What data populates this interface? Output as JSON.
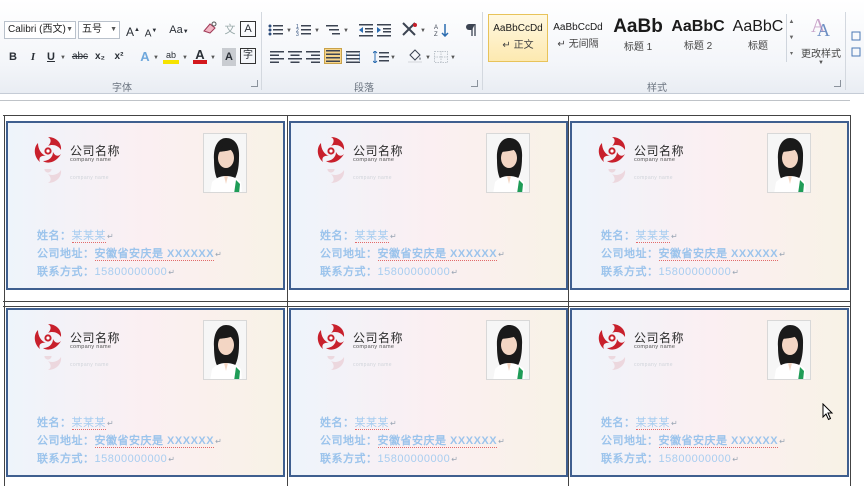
{
  "ribbon": {
    "font_group": {
      "label": "字体",
      "font_name": "Calibri (西文)",
      "font_size": "五号",
      "grow_font": "A",
      "shrink_font": "A",
      "change_case": "Aa",
      "phonetic_char": "文",
      "enclose_char": "A",
      "bold": "B",
      "italic": "I",
      "underline": "U",
      "strikethrough": "abc",
      "subscript": "x₂",
      "superscript": "x²",
      "text_effect": "A",
      "highlight": "ab",
      "font_color": "A",
      "char_shading": "A",
      "char_border": "字"
    },
    "paragraph_group": {
      "label": "段落"
    },
    "styles_group": {
      "label": "样式",
      "items": [
        {
          "preview": "AaBbCcDd",
          "name": "↵ 正文",
          "selected": true
        },
        {
          "preview": "AaBbCcDd",
          "name": "↵ 无间隔",
          "selected": false
        },
        {
          "preview": "AaBb",
          "name": "标题 1",
          "selected": false
        },
        {
          "preview": "AaBbC",
          "name": "标题 2",
          "selected": false
        },
        {
          "preview": "AaBbC",
          "name": "标题",
          "selected": false
        }
      ],
      "change_styles": "更改样式"
    }
  },
  "cards": [
    {
      "company": "公司名称",
      "company_en": "company name",
      "reflect": "company name",
      "name_label": "姓名：",
      "name_value": "某某某",
      "address_label": "公司地址：",
      "address_value": "安徽省安庆是 XXXXXX",
      "contact_label": "联系方式：",
      "contact_value": "15800000000"
    },
    {
      "company": "公司名称",
      "company_en": "company name",
      "reflect": "company name",
      "name_label": "姓名：",
      "name_value": "某某某",
      "address_label": "公司地址：",
      "address_value": "安徽省安庆是 XXXXXX",
      "contact_label": "联系方式：",
      "contact_value": "15800000000"
    },
    {
      "company": "公司名称",
      "company_en": "company name",
      "reflect": "company name",
      "name_label": "姓名：",
      "name_value": "某某某",
      "address_label": "公司地址：",
      "address_value": "安徽省安庆是 XXXXXX",
      "contact_label": "联系方式：",
      "contact_value": "15800000000"
    },
    {
      "company": "公司名称",
      "company_en": "company name",
      "reflect": "company name",
      "name_label": "姓名：",
      "name_value": "某某某",
      "address_label": "公司地址：",
      "address_value": "安徽省安庆是 XXXXXX",
      "contact_label": "联系方式：",
      "contact_value": "15800000000"
    },
    {
      "company": "公司名称",
      "company_en": "company name",
      "reflect": "company name",
      "name_label": "姓名：",
      "name_value": "某某某",
      "address_label": "公司地址：",
      "address_value": "安徽省安庆是 XXXXXX",
      "contact_label": "联系方式：",
      "contact_value": "15800000000"
    },
    {
      "company": "公司名称",
      "company_en": "company name",
      "reflect": "company name",
      "name_label": "姓名：",
      "name_value": "某某某",
      "address_label": "公司地址：",
      "address_value": "安徽省安庆是 XXXXXX",
      "contact_label": "联系方式：",
      "contact_value": "15800000000"
    }
  ],
  "colors": {
    "card_border": "#3f5f8f",
    "field_text": "#9cc4ec",
    "logo_red": "#c8202c",
    "highlight_yellow": "#f6e300",
    "font_red": "#d3181d",
    "style_selected": "#fde9b0"
  },
  "icons": {
    "logo": "triskelion-swirl-logo",
    "photo": "portrait-photo",
    "cursor": "mouse-pointer-icon"
  }
}
